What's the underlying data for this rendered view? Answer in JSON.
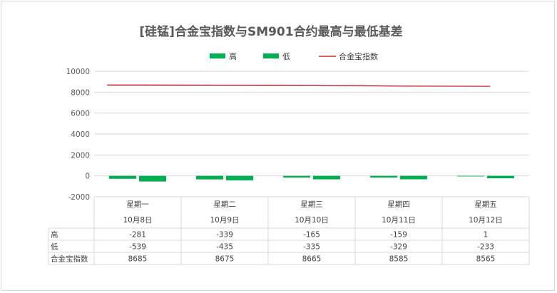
{
  "chart_data": {
    "type": "bar",
    "title": "[硅锰]合金宝指数与SM901合约最高与最低基差",
    "categories": [
      "星期一",
      "星期二",
      "星期三",
      "星期四",
      "星期五"
    ],
    "dates": [
      "10月8日",
      "10月9日",
      "10月10日",
      "10月11日",
      "10月12日"
    ],
    "series": [
      {
        "name": "高",
        "kind": "bar",
        "color": "#00b050",
        "values": [
          -281,
          -339,
          -165,
          -159,
          1
        ]
      },
      {
        "name": "低",
        "kind": "bar",
        "color": "#00b050",
        "values": [
          -539,
          -435,
          -335,
          -329,
          -233
        ]
      },
      {
        "name": "合金宝指数",
        "kind": "line",
        "color": "#c00000",
        "values": [
          8685,
          8675,
          8665,
          8585,
          8565
        ]
      }
    ],
    "yticks": [
      10000,
      8000,
      6000,
      4000,
      2000,
      0,
      -2000
    ],
    "ylim": [
      -2000,
      10000
    ],
    "grid": true,
    "legend": "top"
  }
}
